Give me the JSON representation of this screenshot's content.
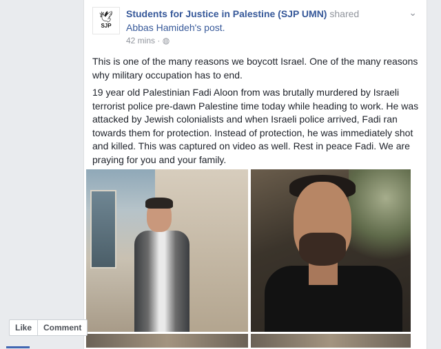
{
  "post": {
    "author": "Students for Justice in Palestine (SJP UMN)",
    "shared_word": "shared",
    "shared_from": "Abbas Hamideh's post.",
    "time": "42 mins",
    "privacy_sep": "·",
    "privacy_icon": "globe-icon",
    "avatar_text": "SJP",
    "paragraph1": "This is one of the many reasons we boycott Israel. One of the many reasons why military occupation has to end.",
    "paragraph2": "19 year old Palestinian Fadi Aloon from was brutally murdered by Israeli terrorist police pre-dawn Palestine time today while heading to work. He was attacked by Jewish colonialists and when Israeli police arrived, Fadi ran towards them for protection. Instead of protection, he was immediately shot and killed. This was captured on video as well. Rest in peace Fadi. We are praying for you and your family."
  },
  "actions": {
    "like": "Like",
    "comment": "Comment"
  },
  "colors": {
    "link": "#365899",
    "background": "#e9ebee"
  }
}
